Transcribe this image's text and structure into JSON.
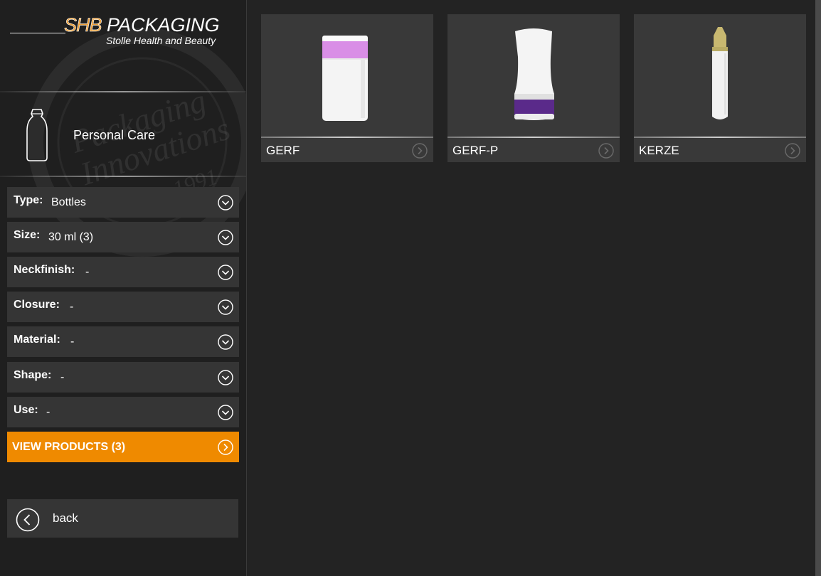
{
  "brand": {
    "shb": "SHB",
    "name": "PACKAGING",
    "tagline": "Stolle Health and Beauty",
    "watermark_lines": [
      "Packaging",
      "Innovations",
      "since 1991"
    ],
    "accent": "#ef8a00"
  },
  "category": {
    "label": "Personal Care",
    "icon": "bottle-outline-icon"
  },
  "filters": [
    {
      "label": "Type:",
      "value": "Bottles"
    },
    {
      "label": "Size:",
      "value": "30 ml (3)"
    },
    {
      "label": "Neckfinish:",
      "value": "-"
    },
    {
      "label": "Closure:",
      "value": "-"
    },
    {
      "label": "Material:",
      "value": "-"
    },
    {
      "label": "Shape:",
      "value": "-"
    },
    {
      "label": "Use:",
      "value": "-"
    }
  ],
  "view_products": {
    "label": "VIEW PRODUCTS (3)"
  },
  "back": {
    "label": "back"
  },
  "products": [
    {
      "name": "GERF",
      "cap_color": "#d98ee6"
    },
    {
      "name": "GERF-P",
      "band_color": "#5a2a8a"
    },
    {
      "name": "KERZE",
      "tip_color": "#c8b870"
    }
  ]
}
